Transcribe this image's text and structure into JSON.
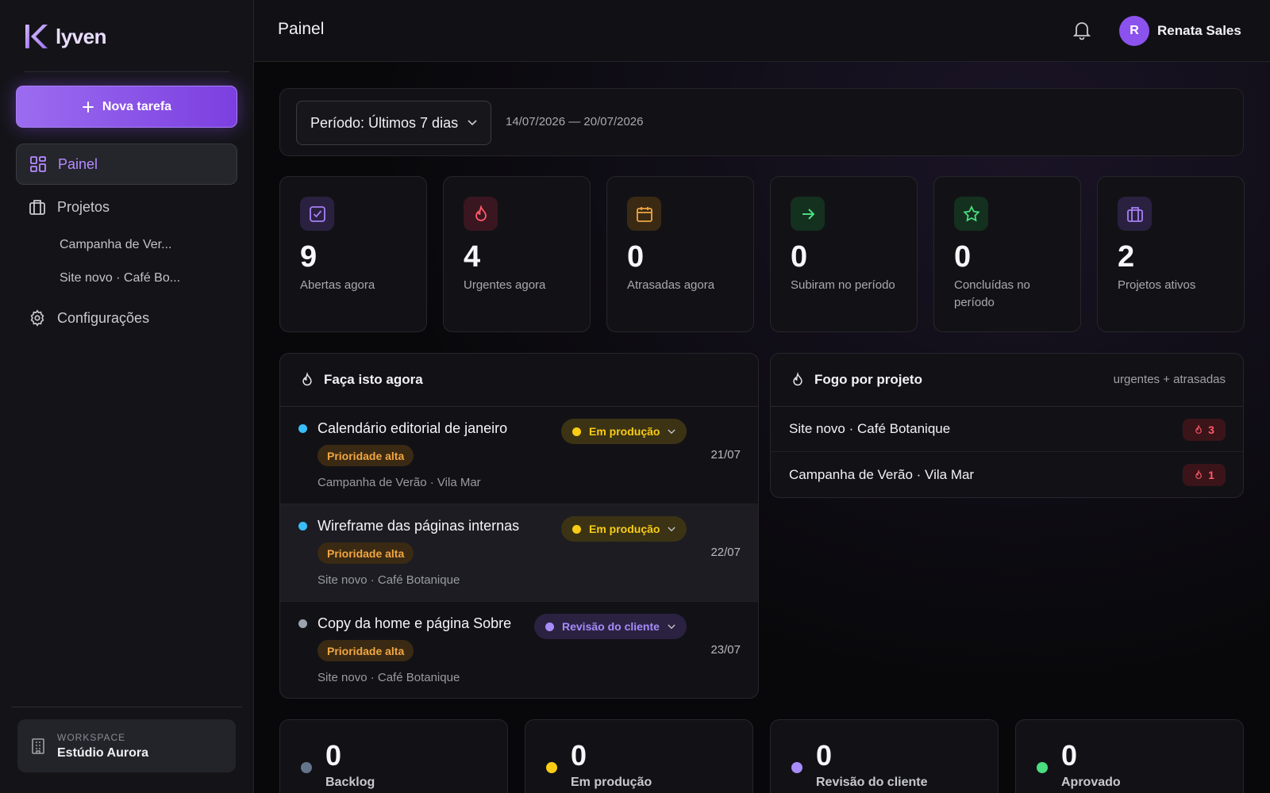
{
  "app": {
    "logo_text": "lyven"
  },
  "sidebar": {
    "new_task_label": "Nova tarefa",
    "nav": {
      "dashboard": "Painel",
      "projects": "Projetos",
      "project_items": [
        "Campanha de Ver...",
        "Site novo · Café Bo..."
      ],
      "settings": "Configurações"
    },
    "workspace": {
      "label": "WORKSPACE",
      "name": "Estúdio Aurora"
    }
  },
  "header": {
    "title": "Painel",
    "user": {
      "initial": "R",
      "name": "Renata Sales"
    }
  },
  "period": {
    "select_label": "Período: Últimos 7 dias",
    "range": "14/07/2026 — 20/07/2026"
  },
  "stats": [
    {
      "value": "9",
      "label": "Abertas agora",
      "icon": "checkbox-icon",
      "color": "#a77ff5"
    },
    {
      "value": "4",
      "label": "Urgentes agora",
      "icon": "flame-icon",
      "color": "#ff5a6a"
    },
    {
      "value": "0",
      "label": "Atrasadas agora",
      "icon": "calendar-icon",
      "color": "#f2a640"
    },
    {
      "value": "0",
      "label": "Subiram no período",
      "icon": "arrow-right-icon",
      "color": "#4ade80"
    },
    {
      "value": "0",
      "label": "Concluídas no período",
      "icon": "star-icon",
      "color": "#4ade80"
    },
    {
      "value": "2",
      "label": "Projetos ativos",
      "icon": "briefcase-icon",
      "color": "#a77ff5"
    }
  ],
  "do_now": {
    "title": "Faça isto agora",
    "tasks": [
      {
        "title": "Calendário editorial de janeiro",
        "priority": "Prioridade alta",
        "project": "Campanha de Verão · Vila Mar",
        "status": "Em produção",
        "date": "21/07",
        "dot_color": "#38bdf8",
        "status_color": "#facc15"
      },
      {
        "title": "Wireframe das páginas internas",
        "priority": "Prioridade alta",
        "project": "Site novo · Café Botanique",
        "status": "Em produção",
        "date": "22/07",
        "dot_color": "#38bdf8",
        "status_color": "#facc15"
      },
      {
        "title": "Copy da home e página Sobre",
        "priority": "Prioridade alta",
        "project": "Site novo · Café Botanique",
        "status": "Revisão do cliente",
        "date": "23/07",
        "dot_color": "#9ca3af",
        "status_color": "#a78bfa"
      }
    ]
  },
  "fire": {
    "title": "Fogo por projeto",
    "aside": "urgentes + atrasadas",
    "projects": [
      {
        "name": "Site novo · Café Botanique",
        "count": "3"
      },
      {
        "name": "Campanha de Verão · Vila Mar",
        "count": "1"
      }
    ]
  },
  "status_cards": [
    {
      "value": "0",
      "label": "Backlog",
      "color": "#64748b"
    },
    {
      "value": "0",
      "label": "Em produção",
      "color": "#facc15"
    },
    {
      "value": "0",
      "label": "Revisão do cliente",
      "color": "#a78bfa"
    },
    {
      "value": "0",
      "label": "Aprovado",
      "color": "#4ade80"
    }
  ]
}
